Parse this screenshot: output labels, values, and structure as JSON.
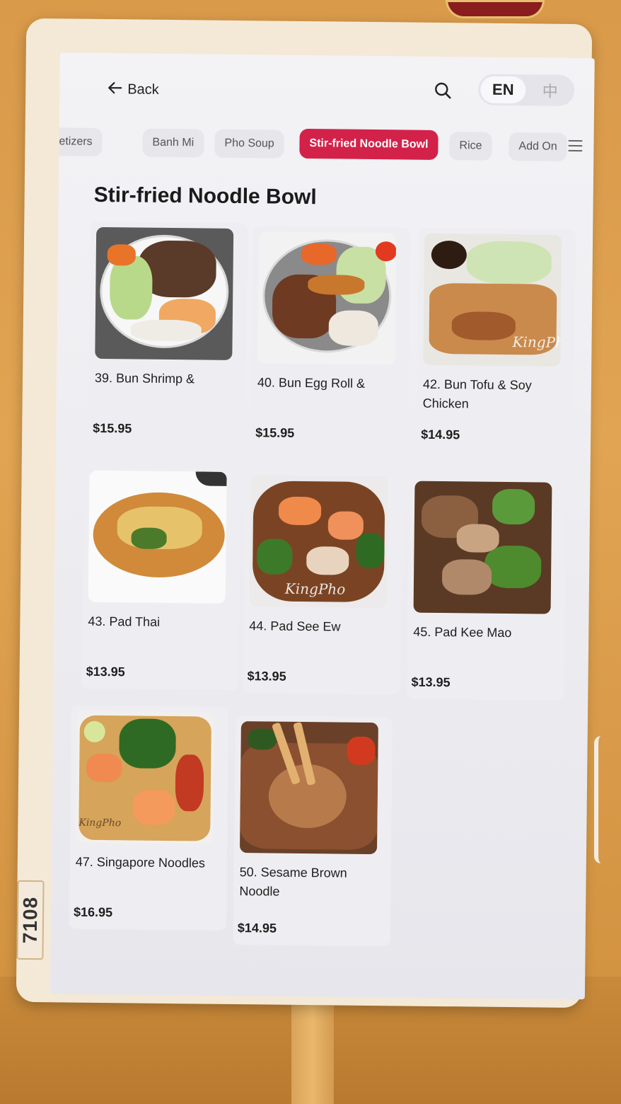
{
  "header": {
    "back_label": "Back",
    "lang_active": "EN",
    "lang_other": "中"
  },
  "tabs": [
    {
      "label": "etizers"
    },
    {
      "label": "Banh Mi"
    },
    {
      "label": "Pho Soup"
    },
    {
      "label": "Stir-fried Noodle Bowl",
      "active": true
    },
    {
      "label": "Rice"
    },
    {
      "label": "Add On"
    }
  ],
  "section_title": "Stir-fried Noodle Bowl",
  "items": [
    {
      "name": "39. Bun Shrimp &",
      "price": "$15.95"
    },
    {
      "name": "40. Bun Egg Roll &",
      "price": "$15.95"
    },
    {
      "name": "42. Bun Tofu & Soy Chicken",
      "price": "$14.95"
    },
    {
      "name": "43. Pad Thai",
      "price": "$13.95"
    },
    {
      "name": "44. Pad See Ew",
      "price": "$13.95"
    },
    {
      "name": "45. Pad Kee Mao",
      "price": "$13.95"
    },
    {
      "name": "47. Singapore Noodles",
      "price": "$16.95"
    },
    {
      "name": "50. Sesame Brown Noodle",
      "price": "$14.95"
    }
  ],
  "watermarks": {
    "item42": "KingPho",
    "item44": "KingPho",
    "item47": "KingPho"
  },
  "sticker": "7108",
  "colors": {
    "accent": "#d3224a",
    "screen_bg": "#f3f2f5",
    "bezel": "#f4e9d6"
  }
}
